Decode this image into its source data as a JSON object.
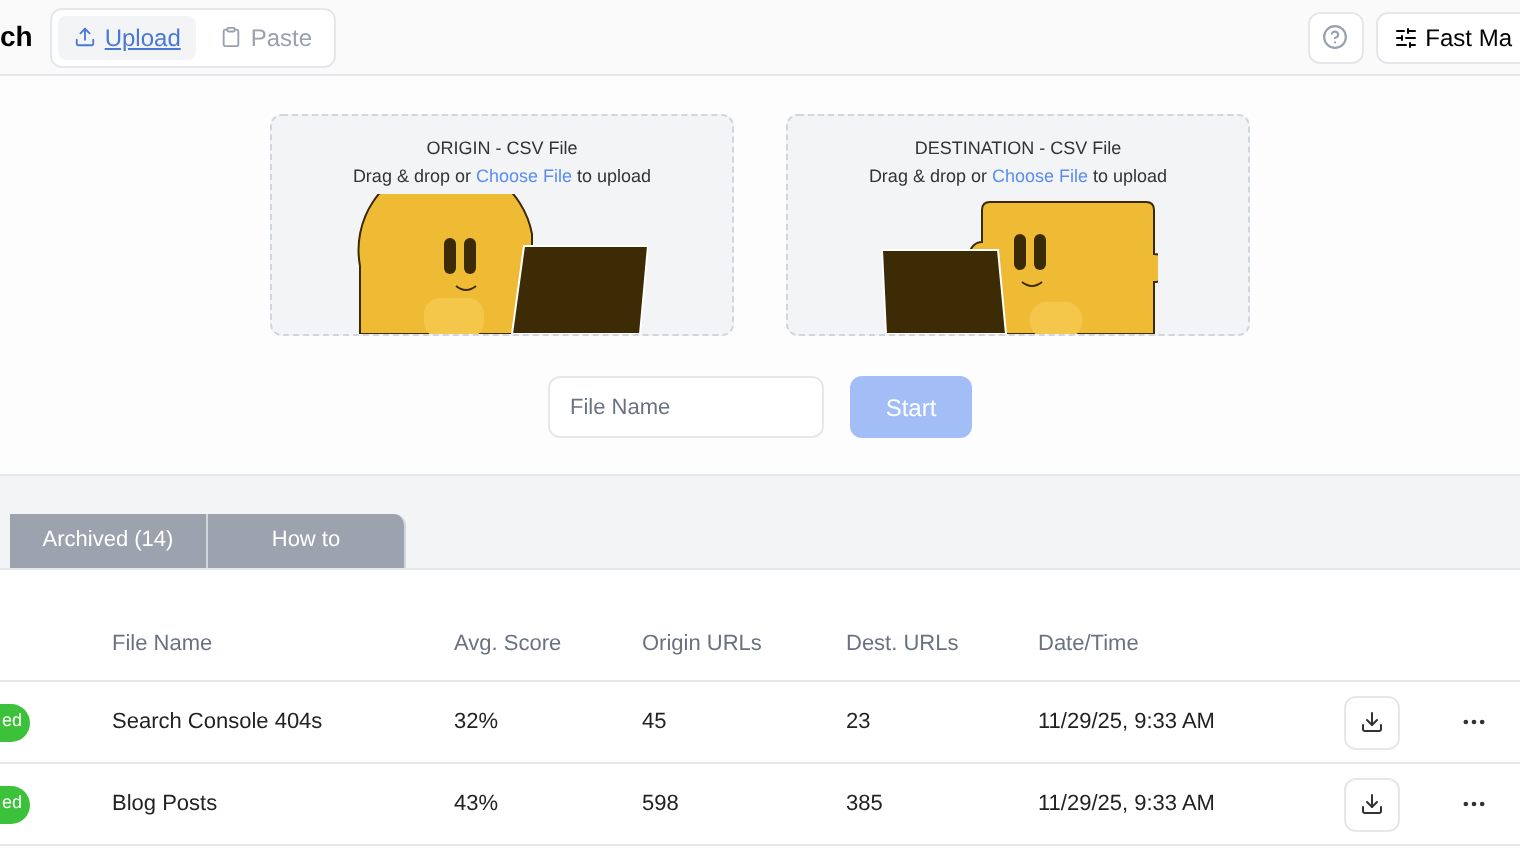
{
  "header": {
    "title": "ch",
    "modes": [
      {
        "label": "Upload",
        "selected": true
      },
      {
        "label": "Paste",
        "selected": false
      }
    ],
    "menu_button": "Fast Ma"
  },
  "dropzones": [
    {
      "title": "ORIGIN - CSV File",
      "prompt_before": "Drag & drop or ",
      "link": "Choose File",
      "prompt_after": " to upload",
      "kind": "round"
    },
    {
      "title": "DESTINATION - CSV File",
      "prompt_before": "Drag & drop or ",
      "link": "Choose File",
      "prompt_after": " to upload",
      "kind": "puzzle"
    }
  ],
  "file_name": {
    "placeholder": "File Name"
  },
  "start_button": {
    "label": "Start",
    "disabled": true
  },
  "tabs": [
    {
      "label": "Archived (14)",
      "selected": false
    },
    {
      "label": "How to",
      "selected": false
    }
  ],
  "table": {
    "columns": [
      "File Name",
      "Avg. Score",
      "Origin URLs",
      "Dest. URLs",
      "Date/Time"
    ],
    "rows": [
      {
        "status": "ed",
        "cells": [
          "Search Console 404s",
          "32%",
          "45",
          "23",
          "11/29/25, 9:33 AM"
        ]
      },
      {
        "status": "ed",
        "cells": [
          "Blog Posts",
          "43%",
          "598",
          "385",
          "11/29/25, 9:33 AM"
        ]
      }
    ]
  }
}
